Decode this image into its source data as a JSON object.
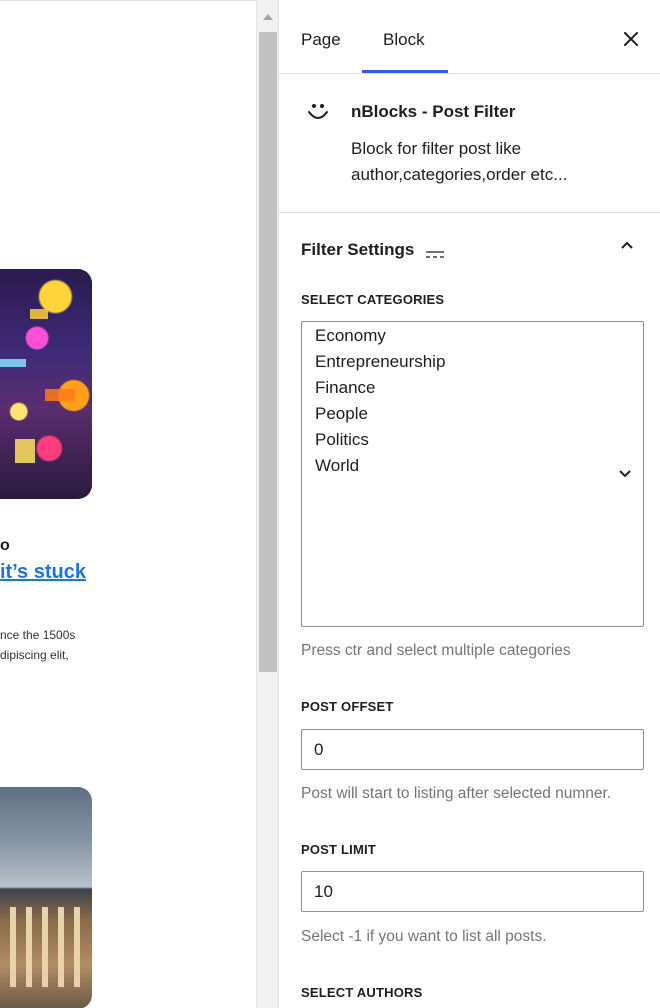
{
  "canvas": {
    "post_title_prev": "o",
    "post_title": "it’s stuck",
    "excerpt_line1": "nce the 1500s",
    "excerpt_line2": "dipiscing elit,"
  },
  "tabs": {
    "page_label": "Page",
    "block_label": "Block",
    "close_icon": "close-icon"
  },
  "block_card": {
    "icon": "smiley-icon",
    "name": "nBlocks - Post Filter",
    "description": "Block for filter post like author,categories,order etc..."
  },
  "panel": {
    "title": "Filter Settings",
    "expanded": true
  },
  "fields": {
    "categories_label": "SELECT CATEGORIES",
    "categories": [
      "Economy",
      "Entrepreneurship",
      "Finance",
      "People",
      "Politics",
      "World"
    ],
    "categories_help": "Press ctr and select multiple categories",
    "offset_label": "POST OFFSET",
    "offset_value": "0",
    "offset_help": "Post will start to listing after selected numner.",
    "limit_label": "POST LIMIT",
    "limit_value": "10",
    "limit_help": "Select -1 if you want to list all posts.",
    "authors_label": "SELECT AUTHORS"
  },
  "colors": {
    "accent": "#3858e9",
    "link": "#1a73e8",
    "help_text": "#757575",
    "border": "#8c8f94"
  }
}
